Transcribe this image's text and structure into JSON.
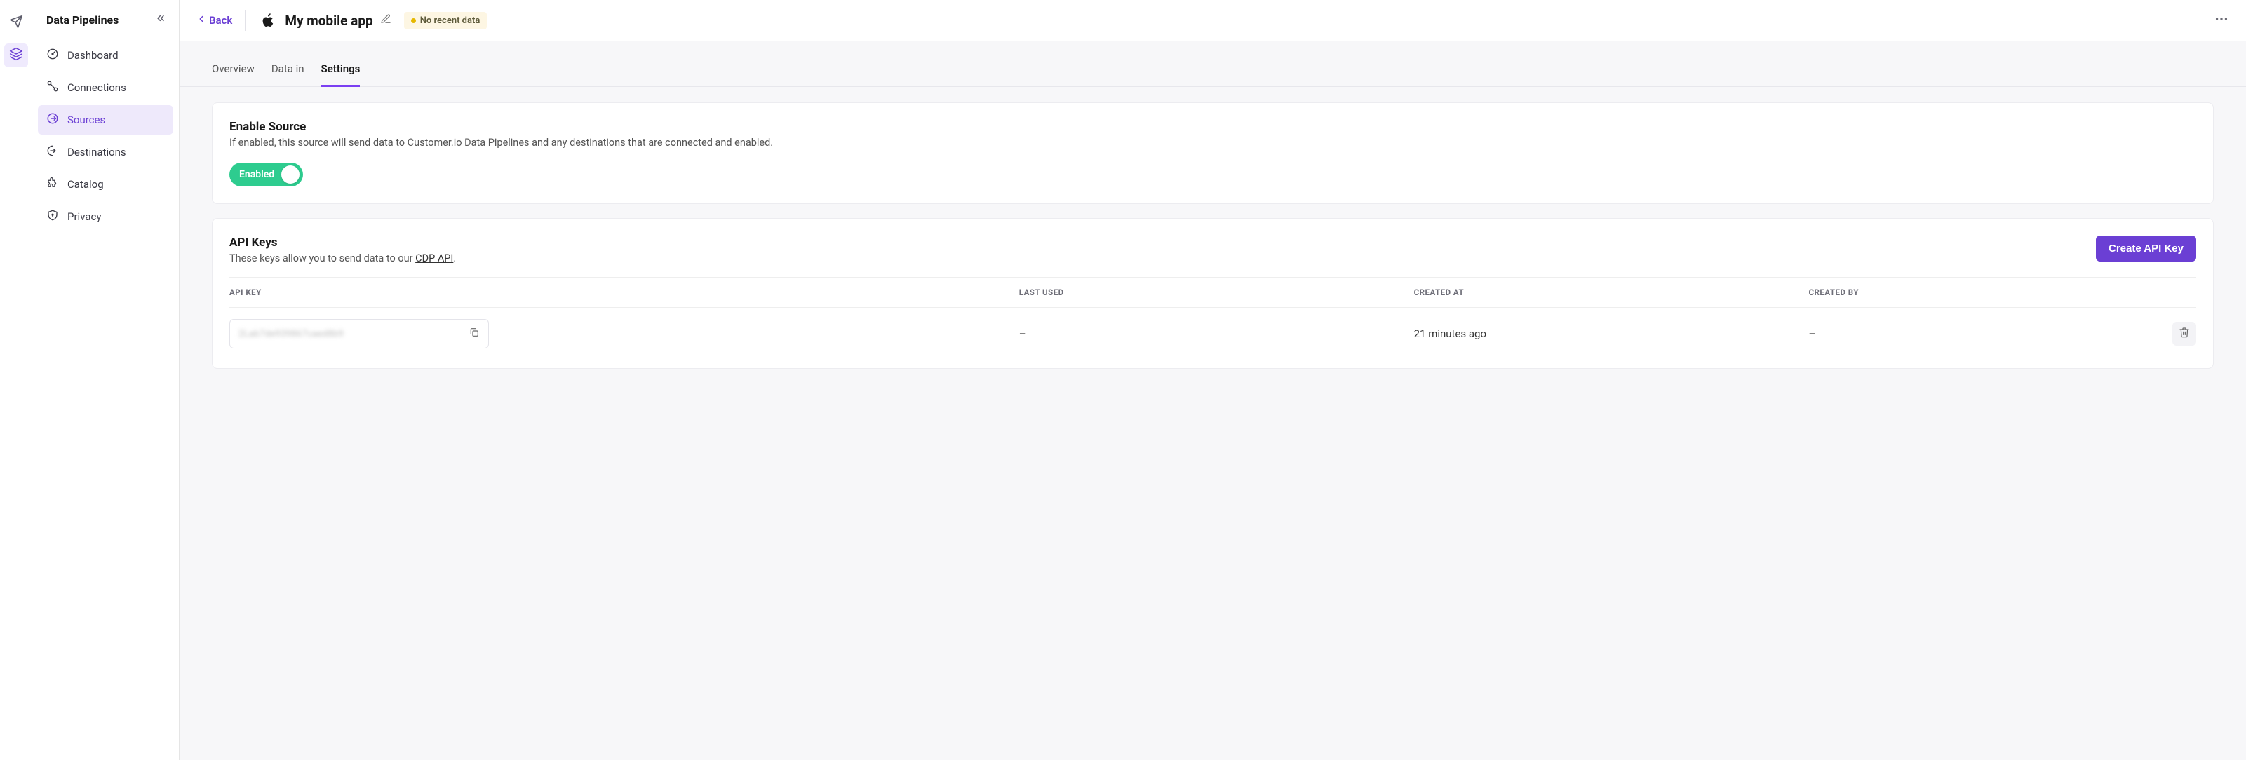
{
  "sidebar": {
    "title": "Data Pipelines",
    "items": [
      {
        "label": "Dashboard"
      },
      {
        "label": "Connections"
      },
      {
        "label": "Sources"
      },
      {
        "label": "Destinations"
      },
      {
        "label": "Catalog"
      },
      {
        "label": "Privacy"
      }
    ]
  },
  "header": {
    "back_label": "Back",
    "app_name": "My mobile app",
    "status_badge": "No recent data"
  },
  "tabs": [
    {
      "label": "Overview"
    },
    {
      "label": "Data in"
    },
    {
      "label": "Settings",
      "active": true
    }
  ],
  "enable_section": {
    "title": "Enable Source",
    "description": "If enabled, this source will send data to Customer.io Data Pipelines and any destinations that are connected and enabled.",
    "toggle_label": "Enabled",
    "toggle_on": true
  },
  "apikeys_section": {
    "title": "API Keys",
    "desc_prefix": "These keys allow you to send data to our ",
    "desc_link": "CDP API",
    "desc_suffix": ".",
    "create_button": "Create API Key",
    "columns": {
      "key": "API KEY",
      "last_used": "LAST USED",
      "created_at": "CREATED AT",
      "created_by": "CREATED BY"
    },
    "rows": [
      {
        "key_masked": "2Lab7de939867caed8b9",
        "last_used": "–",
        "created_at": "21 minutes ago",
        "created_by": "–"
      }
    ]
  }
}
